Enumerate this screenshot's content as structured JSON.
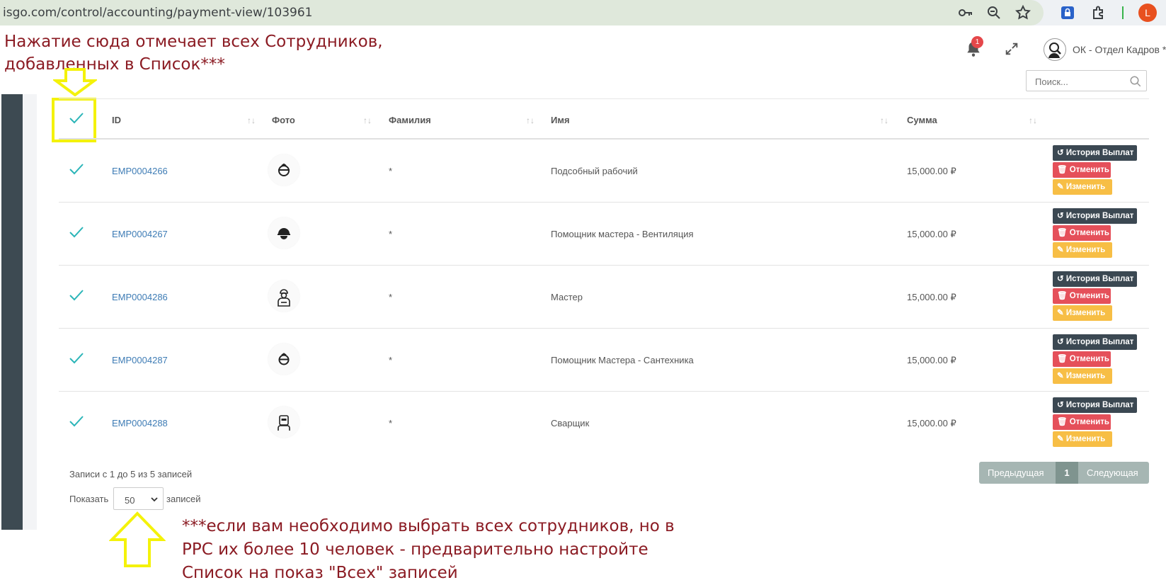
{
  "browser": {
    "url": "isgo.com/control/accounting/payment-view/103961",
    "profile_initial": "L"
  },
  "header": {
    "notification_count": "1",
    "user_name": "ОК - Отдел Кадров *",
    "search_placeholder": "Поиск..."
  },
  "annotations": {
    "top_line1": "Нажатие сюда отмечает всех Сотрудников,",
    "top_line2": "добавленных в Список***",
    "bottom_line1": "***если вам необходимо выбрать всех сотрудников, но в",
    "bottom_line2": "РРС их более 10 человек - предварительно настройте",
    "bottom_line3": "Список на показ \"Всех\" записей"
  },
  "table": {
    "columns": [
      "ID",
      "Фото",
      "Фамилия",
      "Имя",
      "Сумма"
    ],
    "rows": [
      {
        "id": "EMP0004266",
        "photo": "hardhat-icon",
        "surname": "*",
        "name": "Подсобный рабочий",
        "amount": "15,000.00 ₽"
      },
      {
        "id": "EMP0004267",
        "photo": "helmet-icon",
        "surname": "*",
        "name": "Помощник мастера - Вентиляция",
        "amount": "15,000.00 ₽"
      },
      {
        "id": "EMP0004286",
        "photo": "worker-icon",
        "surname": "*",
        "name": "Мастер",
        "amount": "15,000.00 ₽"
      },
      {
        "id": "EMP0004287",
        "photo": "hardhat-icon",
        "surname": "*",
        "name": "Помощник Мастера - Сантехника",
        "amount": "15,000.00 ₽"
      },
      {
        "id": "EMP0004288",
        "photo": "welder-icon",
        "surname": "*",
        "name": "Сварщик",
        "amount": "15,000.00 ₽"
      }
    ],
    "actions": {
      "history": "История Выплат",
      "cancel": "Отменить",
      "edit": "Изменить"
    }
  },
  "footer": {
    "info": "Записи с 1 до 5 из 5 записей",
    "show_label": "Показать",
    "show_value": "50",
    "show_suffix": "записей",
    "prev": "Предыдущая",
    "current_page": "1",
    "next": "Следующая"
  },
  "colors": {
    "accent_check": "#2bb5b8",
    "link": "#3e7cb5",
    "annotation": "#8b1b23",
    "highlight": "#f4f20a"
  }
}
